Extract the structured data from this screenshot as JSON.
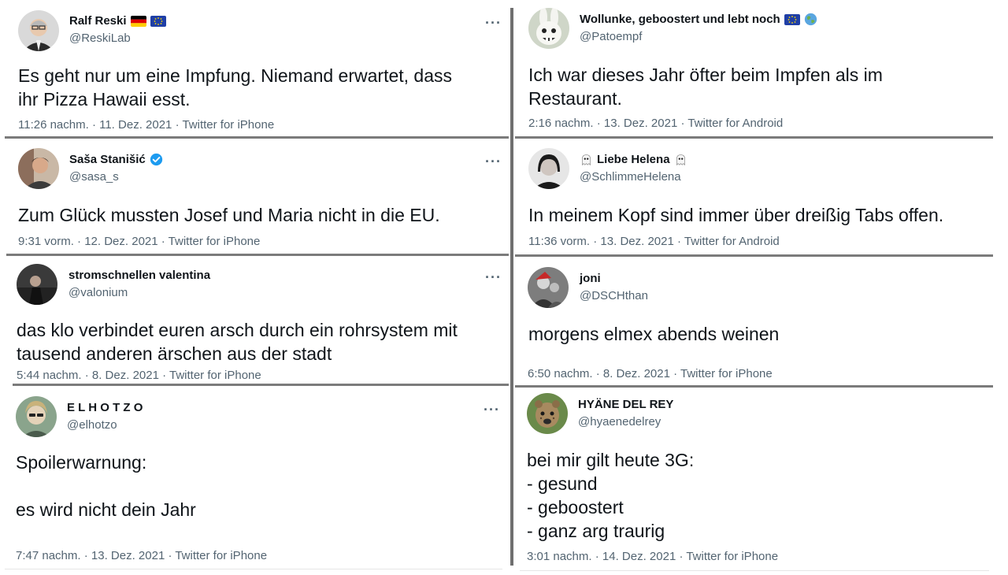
{
  "tweets": [
    {
      "name": "Ralf Reski",
      "handle": "@ReskiLab",
      "text": "Es geht nur um eine Impfung. Niemand erwartet, dass\nihr Pizza Hawaii esst.",
      "timestamp": "11:26 nachm. · 11. Dez. 2021 · Twitter for iPhone",
      "name_badges": [
        "germany-flag-icon",
        "eu-flag-icon"
      ]
    },
    {
      "name": "Wollunke, geboostert und lebt noch",
      "handle": "@Patoempf",
      "text": "Ich war dieses Jahr öfter beim Impfen als im\nRestaurant.",
      "timestamp": "2:16 nachm. · 13. Dez. 2021 · Twitter for Android",
      "name_badges": [
        "eu-flag-icon",
        "globe-icon"
      ]
    },
    {
      "name": "Saša Stanišić",
      "handle": "@sasa_s",
      "text": "Zum Glück mussten Josef und Maria nicht in die EU.",
      "timestamp": "9:31 vorm. · 12. Dez. 2021 · Twitter for iPhone",
      "name_badges": [
        "verified-badge-icon"
      ]
    },
    {
      "name": "Liebe Helena",
      "handle": "@SchlimmeHelena",
      "text": "In meinem Kopf sind immer über dreißig Tabs offen.",
      "timestamp": "11:36 vorm. · 13. Dez. 2021 · Twitter for Android",
      "name_badges": [
        "ghost-icon",
        "ghost-icon"
      ]
    },
    {
      "name": "stromschnellen valentina",
      "handle": "@valonium",
      "text": "das klo verbindet euren arsch durch ein rohrsystem mit\ntausend anderen ärschen aus der stadt",
      "timestamp": "5:44 nachm. · 8. Dez. 2021 · Twitter for iPhone",
      "name_badges": []
    },
    {
      "name": "joni",
      "handle": "@DSCHthan",
      "text": "morgens elmex abends weinen",
      "timestamp": "6:50 nachm. · 8. Dez. 2021 · Twitter for iPhone",
      "name_badges": []
    },
    {
      "name": "E L H O T Z O",
      "handle": "@elhotzo",
      "text": "Spoilerwarnung:\n\nes wird nicht dein Jahr",
      "timestamp": "7:47 nachm. · 13. Dez. 2021 · Twitter for iPhone",
      "name_badges": []
    },
    {
      "name": "HYÄNE DEL REY",
      "handle": "@hyaenedelrey",
      "text": "bei mir gilt heute 3G:\n- gesund\n- geboostert\n- ganz arg traurig",
      "timestamp": "3:01 nachm. · 14. Dez. 2021 · Twitter for iPhone",
      "name_badges": []
    }
  ],
  "more_glyph": "···",
  "colors": {
    "text_primary": "#0f1419",
    "text_secondary": "#536471",
    "verified_blue": "#1d9bf0",
    "separator": "#7b7b7b"
  }
}
